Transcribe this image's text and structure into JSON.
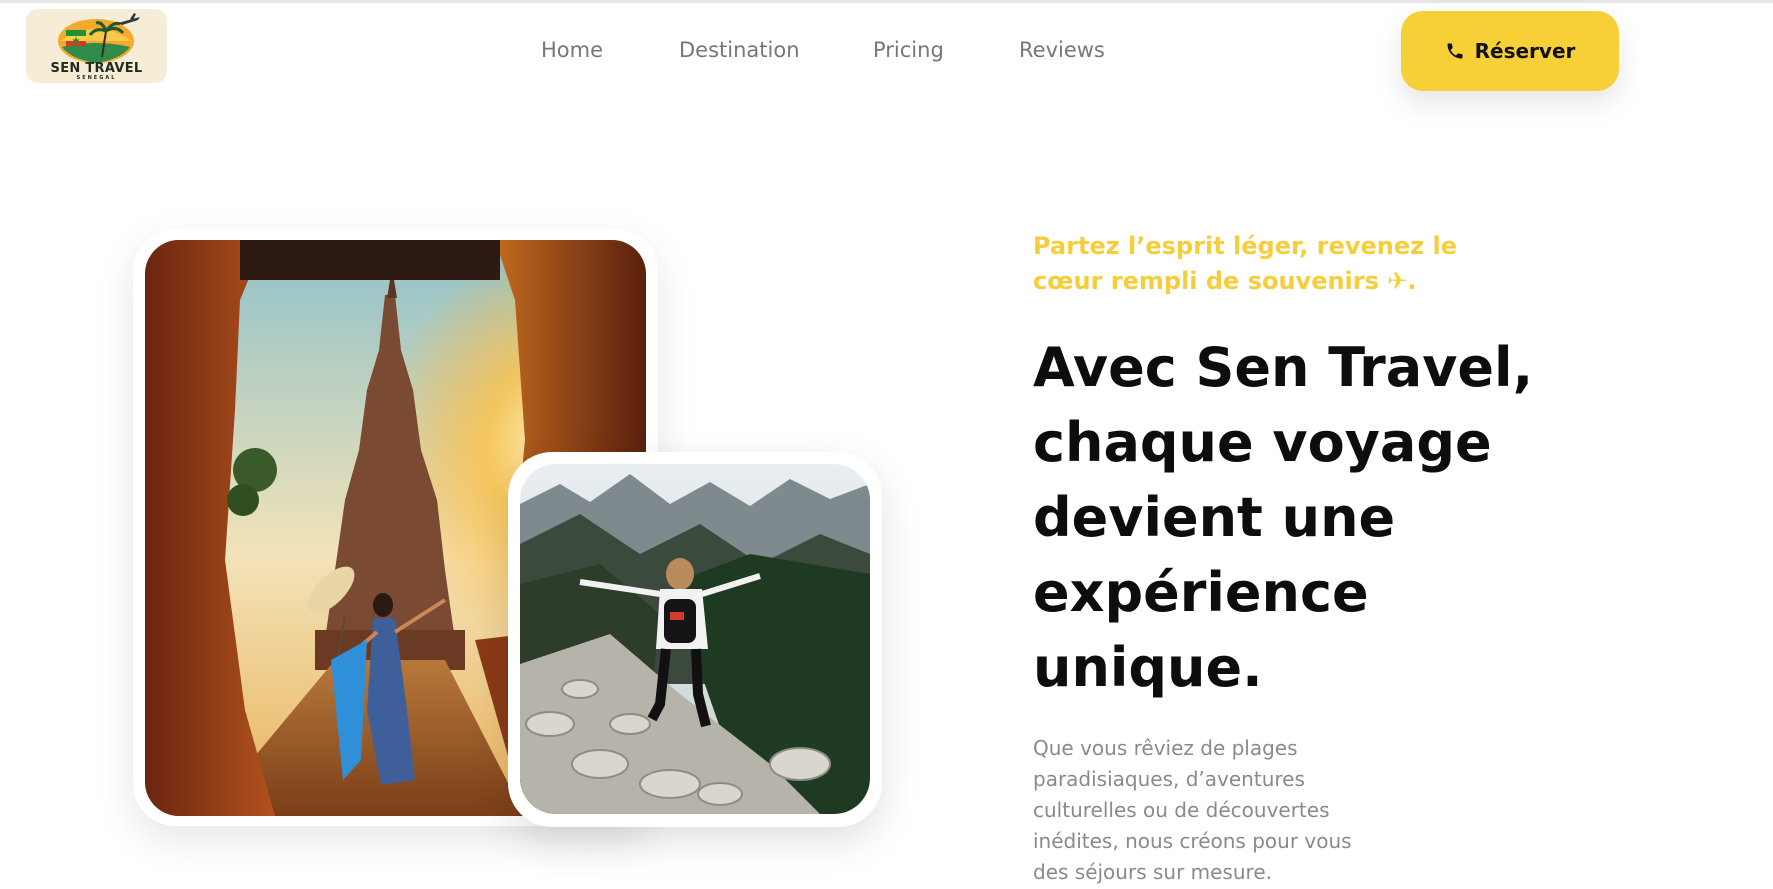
{
  "brand": {
    "name": "SEN TRAVEL",
    "sub": "SENEGAL",
    "colors": {
      "accent": "#f6d036",
      "tagline": "#f6cd3b",
      "nav_text": "#777777",
      "body_text": "#8a8a8a"
    }
  },
  "nav": {
    "items": [
      {
        "label": "Home"
      },
      {
        "label": "Destination"
      },
      {
        "label": "Pricing"
      },
      {
        "label": "Reviews"
      }
    ]
  },
  "cta": {
    "label": "Réserver",
    "icon": "phone-icon"
  },
  "hero": {
    "tagline": "Partez l’esprit léger, revenez le cœur rempli de souvenirs ✈.",
    "headline": "Avec Sen Travel, chaque voyage devient une expérience unique.",
    "description": "Que vous rêviez de plages paradisiaques, d’aventures culturelles ou de découvertes inédites, nous créons pour vous des séjours sur mesure."
  },
  "images": {
    "large": "temple-gate-photo",
    "small": "mountain-hiker-photo"
  }
}
